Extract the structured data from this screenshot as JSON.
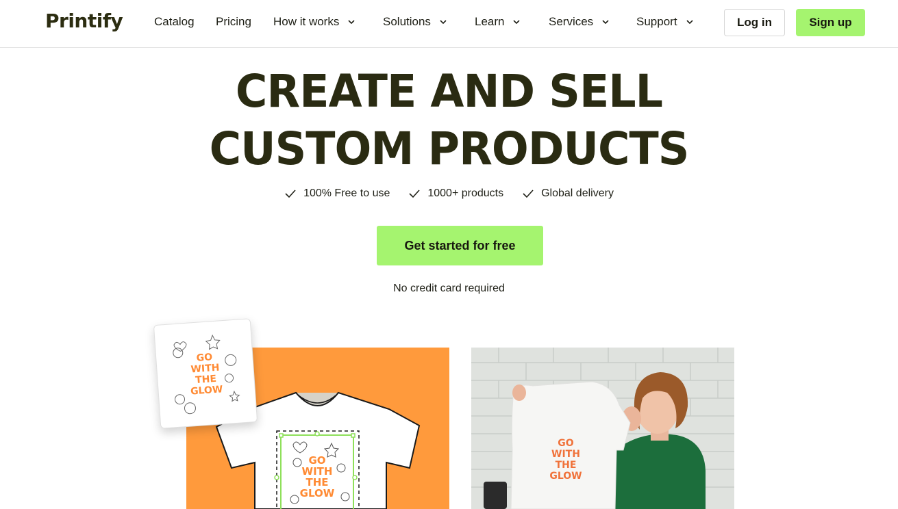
{
  "header": {
    "logo": "Printify",
    "nav": [
      {
        "label": "Catalog",
        "dropdown": false
      },
      {
        "label": "Pricing",
        "dropdown": false
      },
      {
        "label": "How it works",
        "dropdown": true
      },
      {
        "label": "Solutions",
        "dropdown": true
      },
      {
        "label": "Learn",
        "dropdown": true
      },
      {
        "label": "Services",
        "dropdown": true
      },
      {
        "label": "Support",
        "dropdown": true
      }
    ],
    "login_label": "Log in",
    "signup_label": "Sign up"
  },
  "hero": {
    "title_line1": "CREATE AND SELL",
    "title_line2": "CUSTOM PRODUCTS",
    "features": [
      "100% Free to use",
      "1000+ products",
      "Global delivery"
    ],
    "cta_label": "Get started for free",
    "note": "No credit card required"
  },
  "design": {
    "text_lines": [
      "GO",
      "WITH",
      "THE",
      "GLOW"
    ]
  },
  "colors": {
    "accent_green": "#a5f46f",
    "dark_text": "#2a2b12",
    "orange": "#ff9a3c"
  }
}
